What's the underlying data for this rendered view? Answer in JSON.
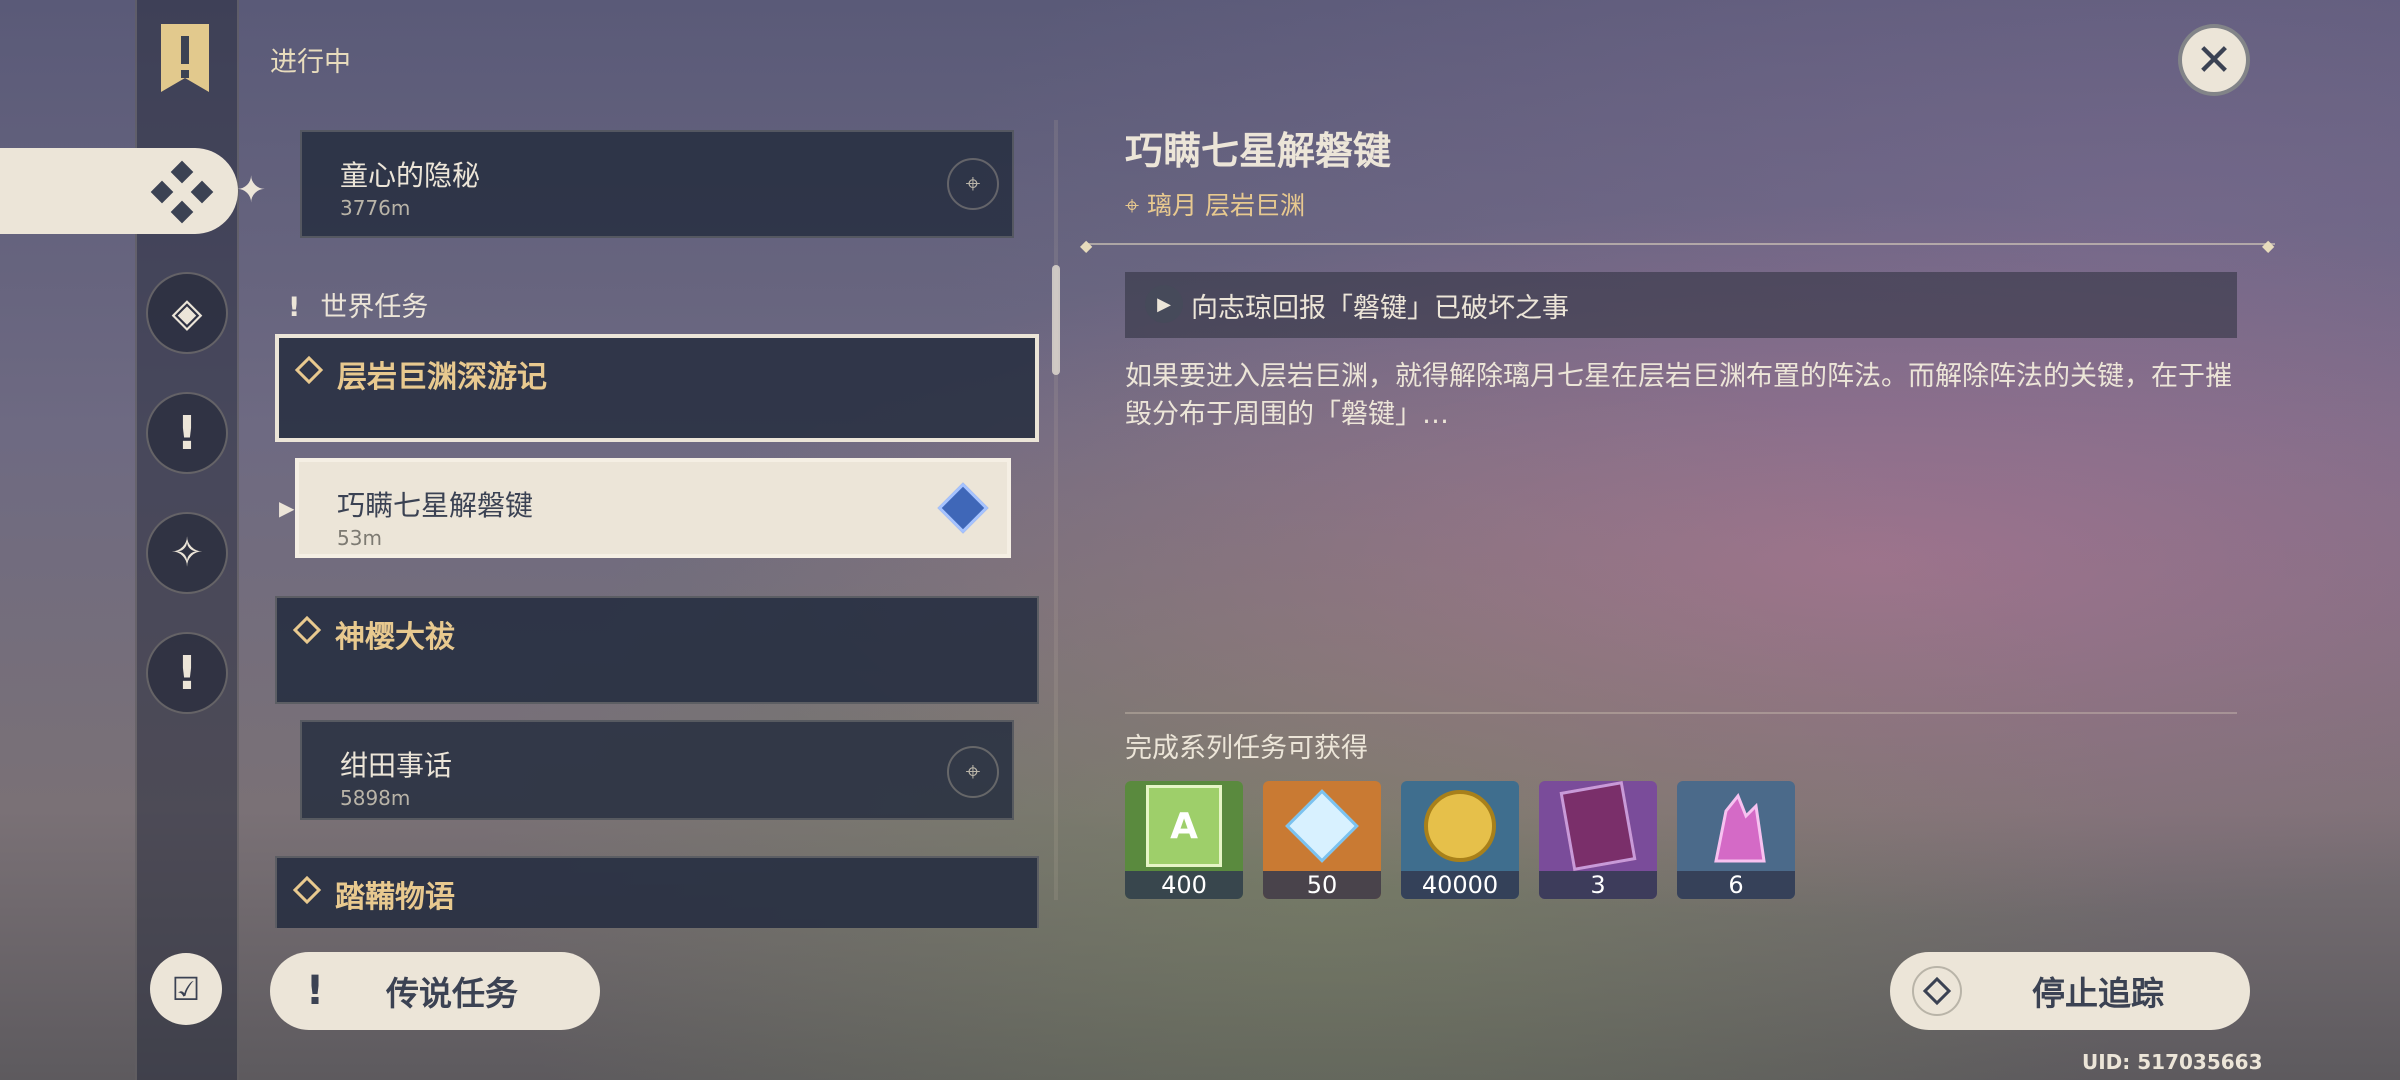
{
  "header": {
    "section_title": "进行中",
    "close_label": "关闭"
  },
  "quest_list": {
    "top_card": {
      "title": "童心的隐秘",
      "distance": "3776m"
    },
    "world_header": "世界任务",
    "groups": [
      {
        "title": "层岩巨渊深游记",
        "quests": [
          {
            "title": "巧瞒七星解磐键",
            "distance": "53m",
            "selected": true
          }
        ]
      },
      {
        "title": "神樱大祓",
        "quests": [
          {
            "title": "绀田事话",
            "distance": "5898m"
          }
        ]
      },
      {
        "title": "踏鞴物语",
        "quests": []
      }
    ]
  },
  "footer": {
    "legend_button": "传说任务",
    "stop_button": "停止追踪",
    "uid": "UID: 517035663"
  },
  "detail": {
    "title": "巧瞒七星解磐键",
    "location": "璃月 层岩巨渊",
    "objective": "向志琼回报「磐键」已破坏之事",
    "description": "如果要进入层岩巨渊，就得解除璃月七星在层岩巨渊布置的阵法。而解除阵法的关键，在于摧毁分布于周围的「磐键」…",
    "reward_title": "完成系列任务可获得",
    "rewards": [
      {
        "icon": "adventure-exp-icon",
        "count": "400",
        "color": "#5a8a3e"
      },
      {
        "icon": "primogem-icon",
        "count": "50",
        "color": "#c97a33"
      },
      {
        "icon": "mora-coin-icon",
        "count": "40000",
        "color": "#3f6e8e"
      },
      {
        "icon": "heros-wit-book-icon",
        "count": "3",
        "color": "#7a4c9a"
      },
      {
        "icon": "mystic-ore-icon",
        "count": "6",
        "color": "#4b6a8a"
      }
    ]
  }
}
